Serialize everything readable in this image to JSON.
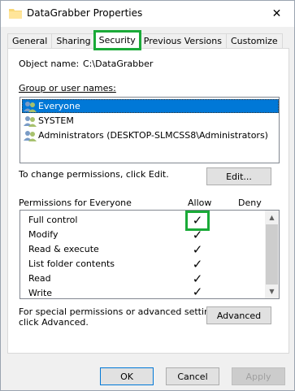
{
  "window": {
    "title": "DataGrabber Properties",
    "close_glyph": "✕"
  },
  "tabs": [
    {
      "label": "General"
    },
    {
      "label": "Sharing"
    },
    {
      "label": "Security"
    },
    {
      "label": "Previous Versions"
    },
    {
      "label": "Customize"
    }
  ],
  "security": {
    "object_name_label": "Object name:",
    "object_name_value": "C:\\DataGrabber",
    "group_label": "Group or user names:",
    "users": [
      {
        "name": "Everyone"
      },
      {
        "name": "SYSTEM"
      },
      {
        "name": "Administrators (DESKTOP-SLMCSS8\\Administrators)"
      }
    ],
    "change_text": "To change permissions, click Edit.",
    "edit_button": "Edit...",
    "permissions_label": "Permissions for Everyone",
    "allow_header": "Allow",
    "deny_header": "Deny",
    "permissions": [
      {
        "name": "Full control",
        "allow": true,
        "deny": false
      },
      {
        "name": "Modify",
        "allow": true,
        "deny": false
      },
      {
        "name": "Read & execute",
        "allow": true,
        "deny": false
      },
      {
        "name": "List folder contents",
        "allow": true,
        "deny": false
      },
      {
        "name": "Read",
        "allow": true,
        "deny": false
      },
      {
        "name": "Write",
        "allow": true,
        "deny": false
      }
    ],
    "check_glyph": "✓",
    "special_text_line1": "For special permissions or advanced settings,",
    "special_text_line2": "click Advanced.",
    "advanced_button": "Advanced"
  },
  "footer": {
    "ok": "OK",
    "cancel": "Cancel",
    "apply": "Apply"
  },
  "colors": {
    "highlight": "#1aaa38",
    "selection": "#0078d7"
  }
}
